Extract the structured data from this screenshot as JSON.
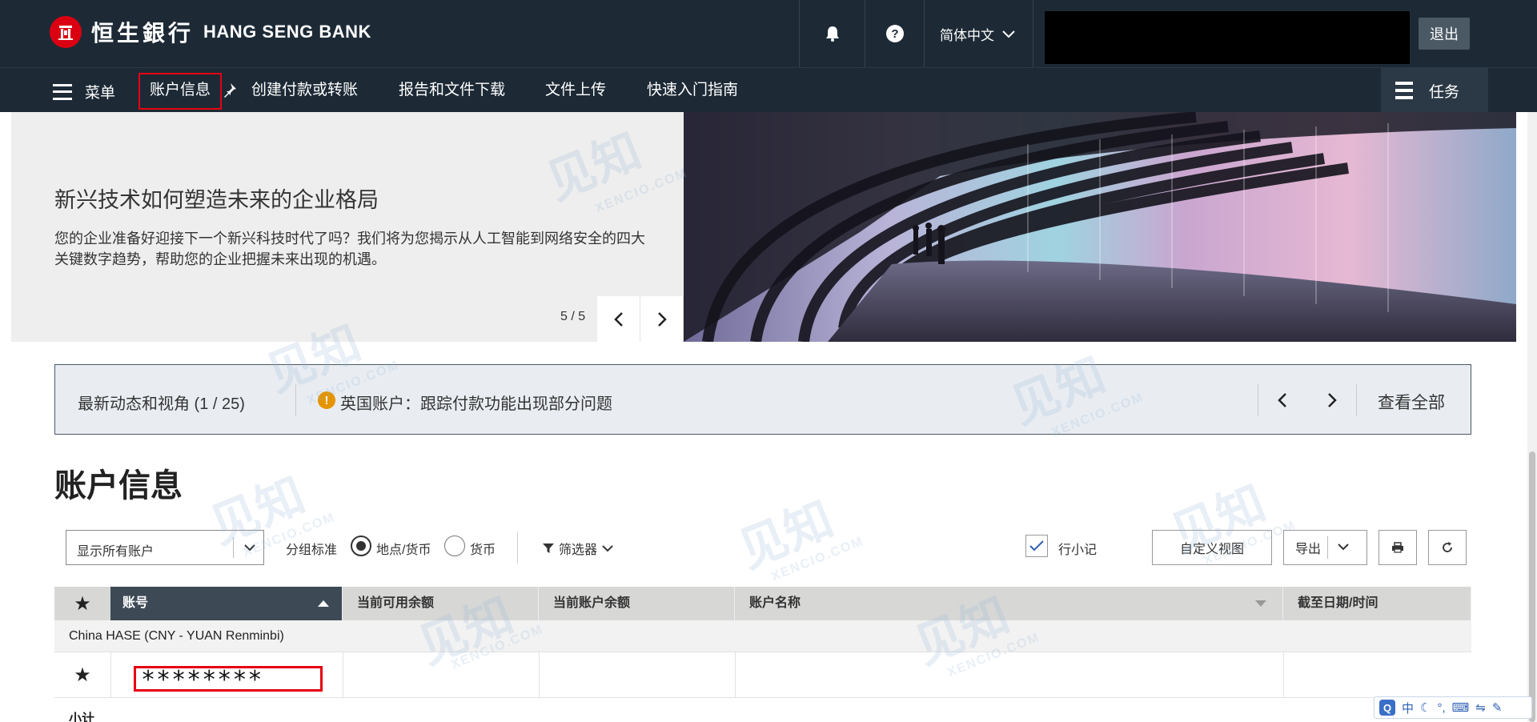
{
  "header": {
    "brand_cn": "恒生銀行",
    "brand_en": "HANG SENG BANK",
    "bell_icon": "bell-icon",
    "help_icon": "question-circle-icon",
    "language": "简体中文",
    "logout_label": "退出"
  },
  "nav": {
    "menu_label": "菜单",
    "items": [
      {
        "label": "账户信息",
        "active": true
      },
      {
        "label": "创建付款或转账"
      },
      {
        "label": "报告和文件下载"
      },
      {
        "label": "文件上传"
      },
      {
        "label": "快速入门指南"
      }
    ],
    "tasks_label": "任务"
  },
  "banner": {
    "title": "新兴技术如何塑造未来的企业格局",
    "text": "您的企业准备好迎接下一个新兴科技时代了吗？我们将为您揭示从人工智能到网络安全的四大关键数字趋势，帮助您的企业把握未来出现的机遇。",
    "slide_counter": "5 / 5"
  },
  "news": {
    "label": "最新动态和视角 (1 / 25)",
    "message": "英国账户：跟踪付款功能出现部分问题",
    "view_all": "查看全部"
  },
  "section": {
    "title": "账户信息"
  },
  "toolbar": {
    "account_filter": "显示所有账户",
    "group_label": "分组标准",
    "radio_location": "地点/货币",
    "radio_currency": "货币",
    "filter_label": "筛选器",
    "subtotal_checkbox": "行小记",
    "custom_view": "自定义视图",
    "export": "导出"
  },
  "table": {
    "columns": [
      "账号",
      "当前可用余额",
      "当前账户余额",
      "账户名称",
      "截至日期/时间"
    ],
    "group": "China HASE (CNY - YUAN Renminbi)",
    "rows": [
      {
        "account": "********"
      }
    ],
    "subtotal": "小计"
  },
  "ime": {
    "lang": "中"
  },
  "watermark": {
    "cn": "见知",
    "en": "XENCIO.COM"
  },
  "colors": {
    "header_bg": "#1d2a36",
    "brand_red": "#db0011",
    "highlight_red": "#e60012",
    "warning": "#e59400"
  }
}
